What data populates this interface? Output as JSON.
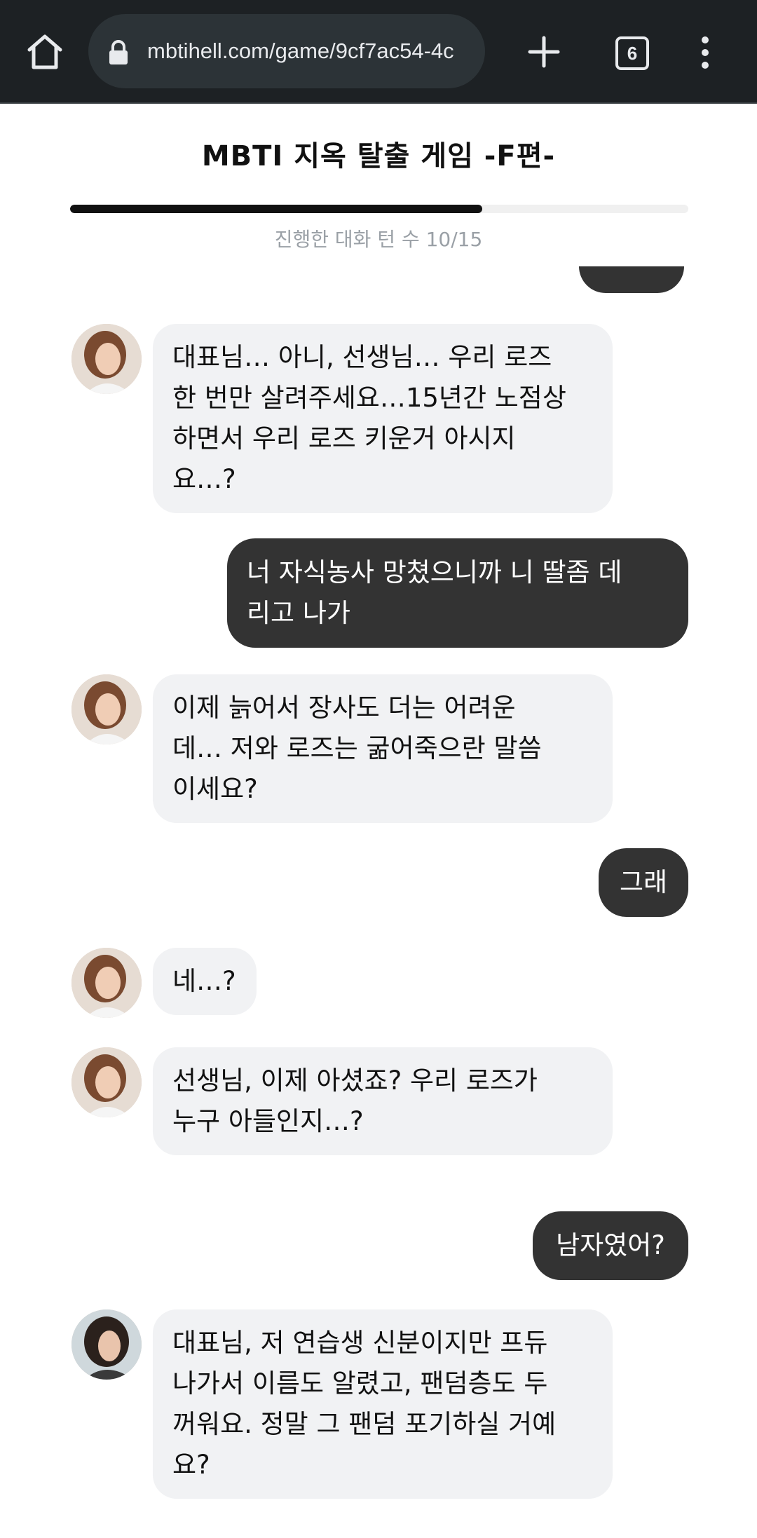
{
  "browser": {
    "url": "mbtihell.com/game/9cf7ac54-4c",
    "tab_count": "6",
    "icons": [
      "home-icon",
      "lock-icon",
      "plus-icon",
      "tabs-icon",
      "more-vert-icon"
    ]
  },
  "header": {
    "title": "MBTI 지옥 탈출 게임 -F편-",
    "progress_label": "진행한 대화 턴 수 10/15",
    "progress_value": 10,
    "progress_max": 15
  },
  "messages": [
    {
      "from": "bot",
      "avatar": "avatar-woman-1",
      "text": "대표님… 아니, 선생님… 우리 로즈\n한 번만 살려주세요…15년간 노점상\n하면서 우리 로즈 키운거 아시지\n요…?"
    },
    {
      "from": "user",
      "text": "너 자식농사 망쳤으니까 니 딸좀 데\n리고 나가"
    },
    {
      "from": "bot",
      "avatar": "avatar-woman-1",
      "text": "이제 늙어서 장사도 더는 어려운\n데… 저와 로즈는 굶어죽으란 말씀\n이세요?"
    },
    {
      "from": "user",
      "text": "그래"
    },
    {
      "from": "bot",
      "avatar": "avatar-woman-1",
      "text": "네…?"
    },
    {
      "from": "bot",
      "avatar": "avatar-woman-1",
      "text": "선생님, 이제 아셨죠? 우리 로즈가\n누구 아들인지…?"
    },
    {
      "from": "user",
      "text": "남자였어?"
    },
    {
      "from": "bot",
      "avatar": "avatar-woman-2",
      "text": "대표님, 저 연습생 신분이지만 프듀\n나가서 이름도 알렸고, 팬덤층도 두\n꺼워요. 정말 그 팬덤 포기하실 거예\n요?"
    }
  ],
  "colors": {
    "chrome_bg": "#1d2124",
    "bot_bubble": "#f1f2f4",
    "user_bubble": "#333333",
    "progress_fill": "#111111"
  }
}
